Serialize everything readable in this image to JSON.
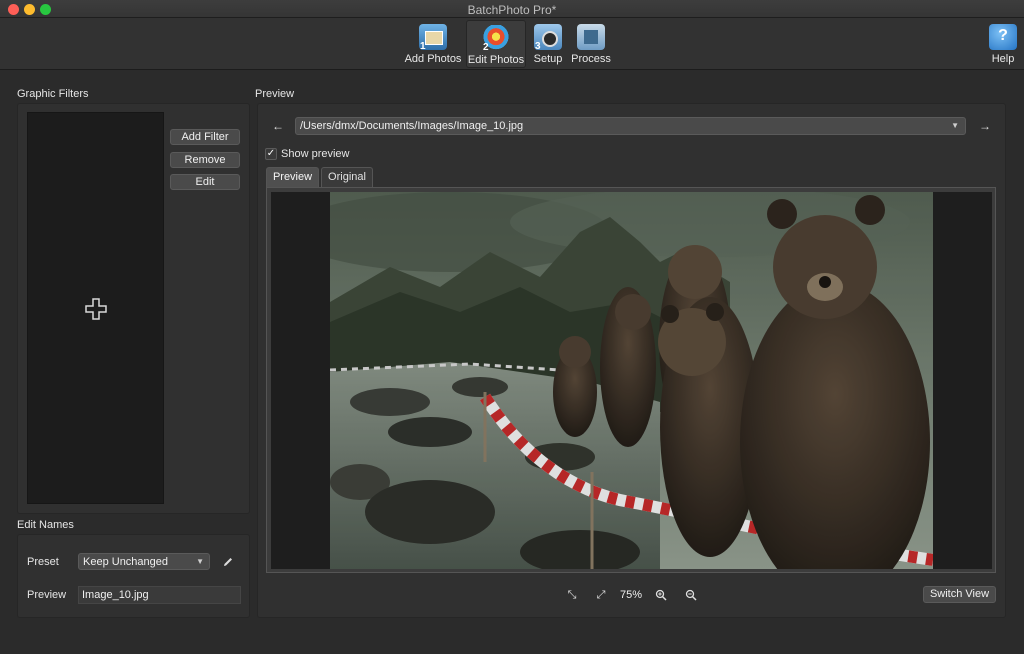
{
  "window": {
    "title": "BatchPhoto Pro*"
  },
  "toolbar": {
    "items": [
      {
        "label": "Add Photos",
        "icon": "add-photos-icon",
        "step": "1"
      },
      {
        "label": "Edit Photos",
        "icon": "edit-photos-icon",
        "step": "2",
        "active": true
      },
      {
        "label": "Setup",
        "icon": "setup-icon",
        "step": "3"
      },
      {
        "label": "Process",
        "icon": "process-icon"
      }
    ],
    "help": {
      "label": "Help",
      "icon": "help-icon",
      "glyph": "?"
    }
  },
  "filters": {
    "title": "Graphic Filters",
    "add_label": "Add Filter",
    "remove_label": "Remove",
    "edit_label": "Edit"
  },
  "edit_names": {
    "title": "Edit Names",
    "preset_label": "Preset",
    "preset_value": "Keep Unchanged",
    "preview_label": "Preview",
    "preview_value": "Image_10.jpg"
  },
  "preview": {
    "title": "Preview",
    "prev_glyph": "←",
    "next_glyph": "→",
    "path": "/Users/dmx/Documents/Images/Image_10.jpg",
    "show_preview_label": "Show preview",
    "show_preview_checked": true,
    "check_glyph": "✓",
    "tabs": [
      "Preview",
      "Original"
    ],
    "zoom": "75%",
    "switch_view_label": "Switch View"
  }
}
